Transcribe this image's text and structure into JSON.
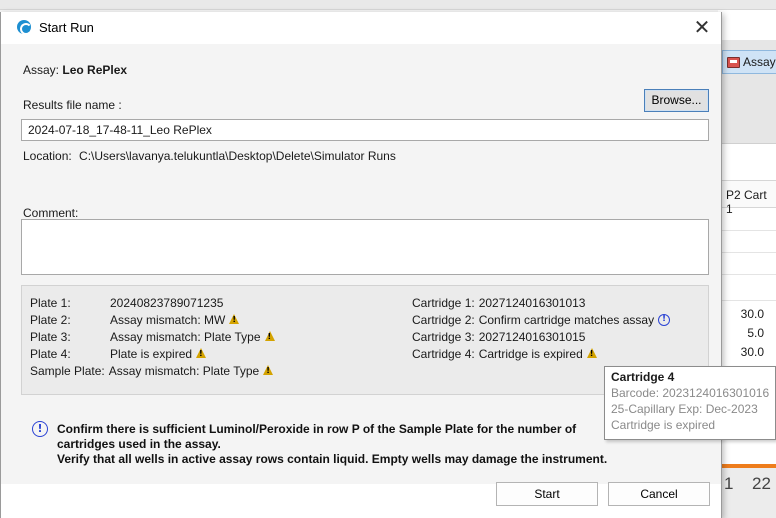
{
  "background": {
    "assay_button": "Assay",
    "column_header": "P2 Cart 1",
    "cells": [
      "30.0",
      "5.0",
      "30.0"
    ],
    "bottom_numbers": [
      "1",
      "22"
    ]
  },
  "dialog": {
    "title": "Start Run",
    "close_glyph": "✕",
    "assay_label": "Assay:",
    "assay_value": "Leo RePlex",
    "results_label": "Results file name :",
    "browse_label": "Browse...",
    "file_name_value": "2024-07-18_17-48-11_Leo RePlex",
    "location_label": "Location:",
    "location_value": "C:\\Users\\lavanya.telukuntla\\Desktop\\Delete\\Simulator Runs",
    "comment_label": "Comment:",
    "comment_value": ""
  },
  "plates": [
    {
      "label": "Plate 1:",
      "value": "20240823789071235",
      "icon": ""
    },
    {
      "label": "Plate 2:",
      "value": "Assay mismatch: MW",
      "icon": "warning-icon"
    },
    {
      "label": "Plate 3:",
      "value": "Assay mismatch: Plate Type",
      "icon": "warning-icon"
    },
    {
      "label": "Plate 4:",
      "value": "Plate is expired",
      "icon": "warning-icon"
    },
    {
      "label": "Sample Plate:",
      "value": "Assay mismatch: Plate Type",
      "icon": "warning-icon"
    }
  ],
  "cartridges": [
    {
      "label": "Cartridge 1:",
      "value": "2027124016301013",
      "icon": ""
    },
    {
      "label": "Cartridge 2:",
      "value": "Confirm cartridge matches assay",
      "icon": "info-icon"
    },
    {
      "label": "Cartridge 3:",
      "value": "2027124016301015",
      "icon": ""
    },
    {
      "label": "Cartridge 4:",
      "value": "Cartridge is expired",
      "icon": "warning-icon"
    }
  ],
  "tooltip": {
    "title": "Cartridge 4",
    "barcode": "Barcode: 2023124016301016",
    "details": "25-Capillary   Exp: Dec-2023",
    "status": "Cartridge is expired"
  },
  "notice": {
    "line1": "Confirm there is sufficient Luminol/Peroxide in row P of the Sample Plate for the number of",
    "line2": "cartridges used in the assay.",
    "line3": "Verify that all wells in active assay rows contain liquid. Empty wells may damage the instrument."
  },
  "buttons": {
    "start": "Start",
    "cancel": "Cancel"
  },
  "colors": {
    "info_blue": "#2b43d4",
    "warning_yellow": "#d4a300",
    "accent_orange": "#ee7d1c"
  }
}
